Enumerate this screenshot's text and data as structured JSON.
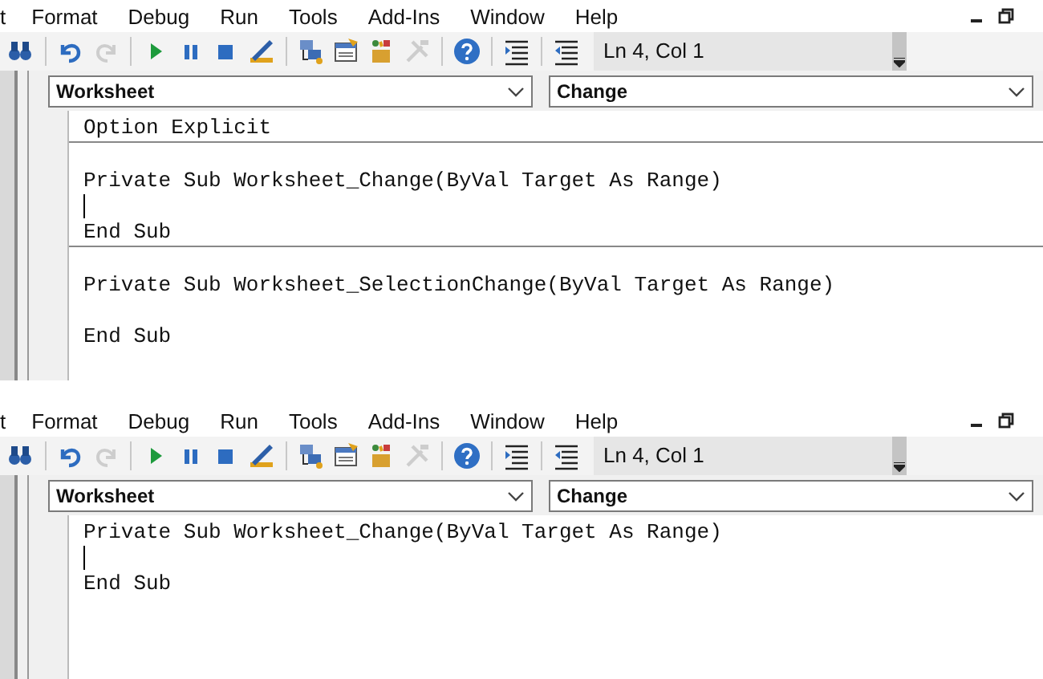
{
  "panels": [
    {
      "menu": [
        {
          "label": "t"
        },
        {
          "label": "Format"
        },
        {
          "label": "Debug"
        },
        {
          "label": "Run"
        },
        {
          "label": "Tools"
        },
        {
          "label": "Add-Ins"
        },
        {
          "label": "Window"
        },
        {
          "label": "Help"
        }
      ],
      "toolbar": [
        {
          "kind": "find",
          "disabled": false
        },
        {
          "kind": "sep"
        },
        {
          "kind": "undo",
          "disabled": false
        },
        {
          "kind": "redo",
          "disabled": true
        },
        {
          "kind": "sep"
        },
        {
          "kind": "run",
          "disabled": false
        },
        {
          "kind": "pause",
          "disabled": false
        },
        {
          "kind": "stop",
          "disabled": false
        },
        {
          "kind": "design",
          "disabled": false
        },
        {
          "kind": "sep"
        },
        {
          "kind": "project",
          "disabled": false
        },
        {
          "kind": "properties",
          "disabled": false
        },
        {
          "kind": "browser",
          "disabled": false
        },
        {
          "kind": "toolbox",
          "disabled": true
        },
        {
          "kind": "sep"
        },
        {
          "kind": "help",
          "disabled": false
        },
        {
          "kind": "sep"
        },
        {
          "kind": "indent",
          "disabled": false
        },
        {
          "kind": "sep"
        },
        {
          "kind": "outdent",
          "disabled": false
        }
      ],
      "position": "Ln 4, Col 1",
      "object_dropdown": "Worksheet",
      "procedure_dropdown": "Change",
      "code_blocks": [
        [
          {
            "kind": "code",
            "text": "Option Explicit"
          }
        ],
        [
          {
            "kind": "blank"
          },
          {
            "kind": "code",
            "text": "Private Sub Worksheet_Change(ByVal Target As Range)"
          },
          {
            "kind": "cursor"
          },
          {
            "kind": "code",
            "text": "End Sub"
          }
        ],
        [
          {
            "kind": "blank"
          },
          {
            "kind": "code",
            "text": "Private Sub Worksheet_SelectionChange(ByVal Target As Range)"
          },
          {
            "kind": "blank"
          },
          {
            "kind": "code",
            "text": "End Sub"
          }
        ]
      ]
    },
    {
      "menu": [
        {
          "label": "t"
        },
        {
          "label": "Format"
        },
        {
          "label": "Debug"
        },
        {
          "label": "Run"
        },
        {
          "label": "Tools"
        },
        {
          "label": "Add-Ins"
        },
        {
          "label": "Window"
        },
        {
          "label": "Help"
        }
      ],
      "toolbar": [
        {
          "kind": "find",
          "disabled": false
        },
        {
          "kind": "sep"
        },
        {
          "kind": "undo",
          "disabled": false
        },
        {
          "kind": "redo",
          "disabled": true
        },
        {
          "kind": "sep"
        },
        {
          "kind": "run",
          "disabled": false
        },
        {
          "kind": "pause",
          "disabled": false
        },
        {
          "kind": "stop",
          "disabled": false
        },
        {
          "kind": "design",
          "disabled": false
        },
        {
          "kind": "sep"
        },
        {
          "kind": "project",
          "disabled": false
        },
        {
          "kind": "properties",
          "disabled": false
        },
        {
          "kind": "browser",
          "disabled": false
        },
        {
          "kind": "toolbox",
          "disabled": true
        },
        {
          "kind": "sep"
        },
        {
          "kind": "help",
          "disabled": false
        },
        {
          "kind": "sep"
        },
        {
          "kind": "indent",
          "disabled": false
        },
        {
          "kind": "sep"
        },
        {
          "kind": "outdent",
          "disabled": false
        }
      ],
      "position": "Ln 4, Col 1",
      "object_dropdown": "Worksheet",
      "procedure_dropdown": "Change",
      "code_blocks": [
        [
          {
            "kind": "code",
            "text": "Private Sub Worksheet_Change(ByVal Target As Range)"
          },
          {
            "kind": "cursor"
          },
          {
            "kind": "code",
            "text": "End Sub"
          }
        ]
      ]
    }
  ]
}
